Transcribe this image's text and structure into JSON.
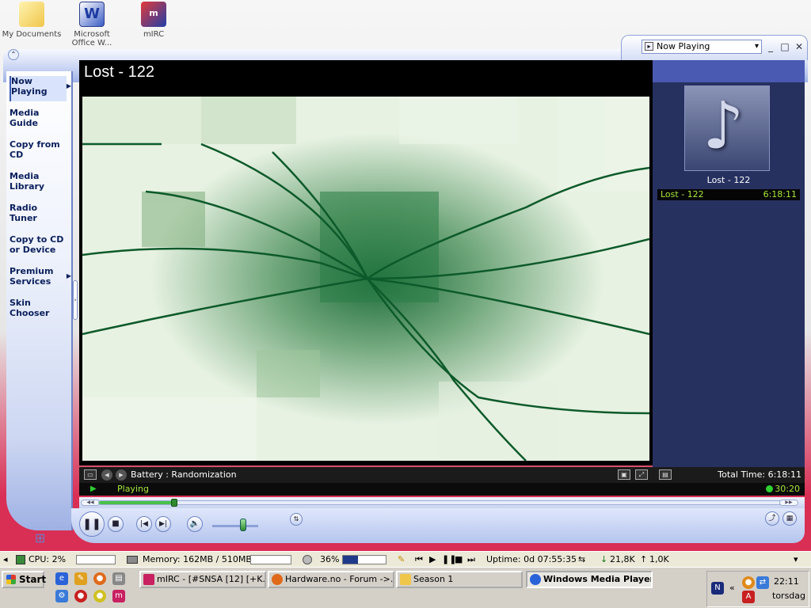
{
  "desktop": {
    "icons": [
      {
        "label": "My Documents",
        "icon": "folder-icon"
      },
      {
        "label": "Microsoft Office W...",
        "icon": "word-icon"
      },
      {
        "label": "mIRC",
        "icon": "mirc-icon"
      }
    ]
  },
  "wmp": {
    "view_selector": "Now Playing",
    "sidebar": [
      {
        "label": "Now Playing",
        "active": true,
        "arrow": true
      },
      {
        "label": "Media Guide"
      },
      {
        "label": "Copy from CD"
      },
      {
        "label": "Media Library"
      },
      {
        "label": "Radio Tuner"
      },
      {
        "label": "Copy to CD or Device"
      },
      {
        "label": "Premium Services",
        "arrow": true
      },
      {
        "label": "Skin Chooser"
      }
    ],
    "video_title": "Lost - 122",
    "visualization": "Battery : Randomization",
    "playlist": {
      "album_caption": "Lost - 122",
      "items": [
        {
          "title": "Lost - 122",
          "duration": "6:18:11"
        }
      ],
      "total_time": "Total Time: 6:18:11"
    },
    "status": {
      "state": "Playing",
      "elapsed": "30:20"
    },
    "seek_progress": 0.11,
    "volume_level": 0.6
  },
  "info_strip": {
    "cpu": "CPU: 2%",
    "memory": "Memory: 162MB / 510MB",
    "disk": "36%",
    "uptime": "Uptime: 0d 07:55:35",
    "net_down": "21,8K",
    "net_up": "1,0K"
  },
  "taskbar": {
    "start": "Start",
    "tasks": [
      {
        "label": "mIRC - [#SNSA [12] [+K...",
        "pressed": false
      },
      {
        "label": "Hardware.no - Forum ->...",
        "pressed": false
      },
      {
        "label": "Season 1",
        "pressed": false
      },
      {
        "label": "Windows Media Player",
        "pressed": true
      }
    ],
    "clock": "22:11",
    "day": "torsdag"
  },
  "colors": {
    "accent": "#4a5ab2",
    "status_text": "#a8e83c",
    "desktop_bottom": "#d92f55"
  }
}
